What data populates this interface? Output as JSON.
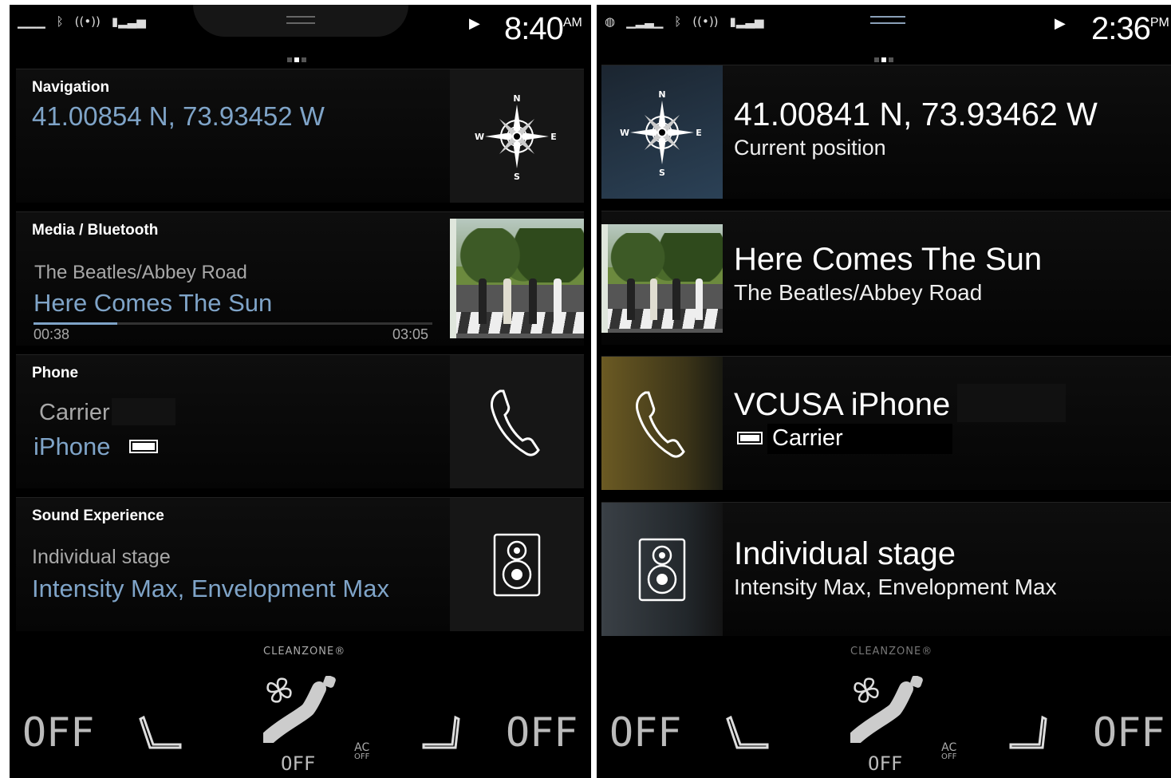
{
  "left": {
    "status": {
      "clock_time": "8:40",
      "clock_suffix": "AM"
    },
    "navigation": {
      "title": "Navigation",
      "coords": "41.00854 N, 73.93452 W"
    },
    "media": {
      "title": "Media / Bluetooth",
      "artist_album": "The Beatles/Abbey Road",
      "track": "Here Comes The Sun",
      "elapsed": "00:38",
      "duration": "03:05",
      "progress": 0.21
    },
    "phone": {
      "title": "Phone",
      "carrier": "Carrier",
      "device": "iPhone"
    },
    "sound": {
      "title": "Sound Experience",
      "mode": "Individual stage",
      "settings": "Intensity Max, Envelopment Max"
    }
  },
  "right": {
    "status": {
      "clock_time": "2:36",
      "clock_suffix": "PM"
    },
    "navigation": {
      "coords": "41.00841 N, 73.93462 W",
      "subtitle": "Current position"
    },
    "media": {
      "track": "Here Comes The Sun",
      "artist_album": "The Beatles/Abbey Road"
    },
    "phone": {
      "device": "VCUSA iPhone",
      "carrier": "Carrier"
    },
    "sound": {
      "mode": "Individual stage",
      "settings": "Intensity Max, Envelopment Max"
    }
  },
  "compass": {
    "n": "N",
    "s": "S",
    "e": "E",
    "w": "W"
  },
  "climate": {
    "cleanzone": "CLEANZONE®",
    "left_temp": "OFF",
    "right_temp": "OFF",
    "fan_label": "OFF",
    "ac_label": "AC",
    "ac_state": "OFF"
  },
  "colors": {
    "accent_blue": "#7fa4c8",
    "phone_tile_gold": "#6b5a23",
    "nav_tile_blue": "#2b4156"
  }
}
